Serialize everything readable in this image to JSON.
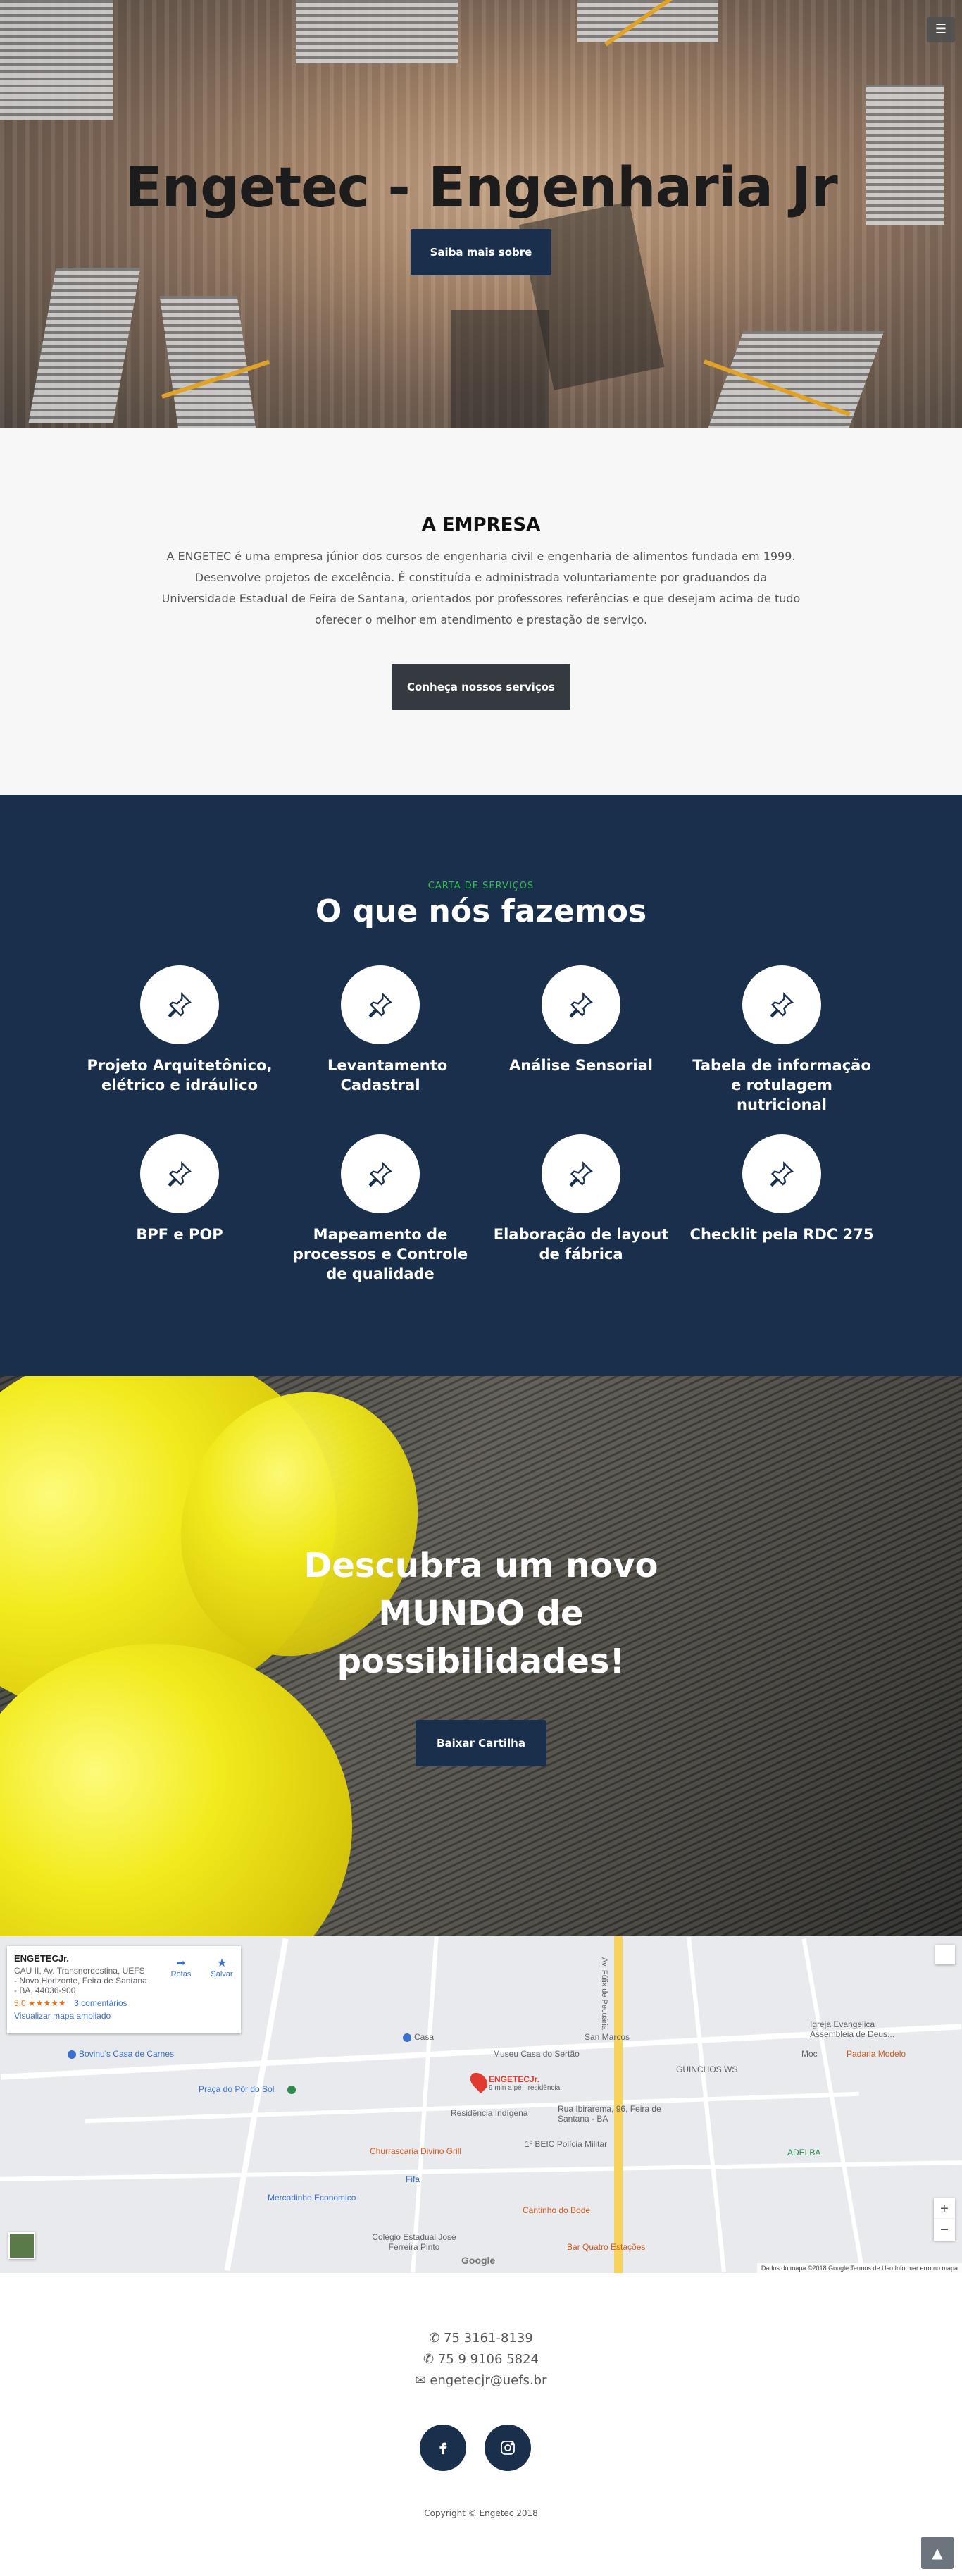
{
  "hero": {
    "title": "Engetec - Engenharia Jr",
    "button": "Saiba mais sobre",
    "menu_icon": "menu-icon"
  },
  "empresa": {
    "heading": "A EMPRESA",
    "text": "A ENGETEC é uma empresa júnior dos cursos de engenharia civil e engenharia de alimentos fundada em 1999. Desenvolve projetos de excelência. É constituída e administrada voluntariamente por graduandos da Universidade Estadual de Feira de Santana, orientados por professores referências e que desejam acima de tudo oferecer o melhor em atendimento e prestação de serviço.",
    "button": "Conheça nossos serviços"
  },
  "services": {
    "kicker": "CARTA DE SERVIÇOS",
    "heading": "O que nós fazemos",
    "items": [
      {
        "title": "Projeto Arquitetônico, elétrico e idráulico",
        "icon": "pushpin-icon"
      },
      {
        "title": "Levantamento Cadastral",
        "icon": "pushpin-icon"
      },
      {
        "title": "Análise Sensorial",
        "icon": "pushpin-icon"
      },
      {
        "title": "Tabela de informação e rotulagem nutricional",
        "icon": "pushpin-icon"
      },
      {
        "title": "BPF e POP",
        "icon": "pushpin-icon"
      },
      {
        "title": "Mapeamento de processos e Controle de qualidade",
        "icon": "pushpin-icon"
      },
      {
        "title": "Elaboração de layout de fábrica",
        "icon": "pushpin-icon"
      },
      {
        "title": "Checklit pela RDC 275",
        "icon": "pushpin-icon"
      }
    ]
  },
  "descubra": {
    "heading": "Descubra um novo MUNDO de possibilidades!",
    "button": "Baixar Cartilha"
  },
  "map": {
    "card": {
      "name": "ENGETECJr.",
      "address": "CAU II, Av. Transnordestina, UEFS - Novo Horizonte, Feira de Santana - BA, 44036-900",
      "rating": "5,0 ★★★★★",
      "comments": "3 comentários",
      "larger_map": "Visualizar mapa ampliado",
      "directions": "Rotas",
      "save": "Salvar"
    },
    "labels": {
      "bovinus": "Bovinu's Casa de Carnes",
      "casa": "Casa",
      "museu": "Museu Casa do Sertão",
      "san_marcos": "San Marcos",
      "igreja": "Igreja Evangelica Assembleia de Deus...",
      "moc": "Moc",
      "padaria": "Padaria Modelo",
      "guinchos": "GUINCHOS WS",
      "praca": "Praça do Pôr do Sol",
      "engetec": "ENGETECJr.",
      "engetec_sub": "9 min a pé · residência",
      "residencia": "Residência Indígena",
      "rua": "Rua Ibirarema, 96, Feira de Santana - BA",
      "churrascaria": "Churrascaria Divino Grill",
      "beic": "1º BEIC Polícia Militar",
      "fifa": "Fifa",
      "mercadinho": "Mercadinho Economico",
      "cantinho": "Cantinho do Bode",
      "colegio": "Colégio Estadual José Ferreira Pinto",
      "bar": "Bar Quatro Estações",
      "adelba": "ADELBA",
      "av": "Av. Fúlix de Pecuária"
    },
    "google": "Google",
    "footer": "Dados do mapa ©2018 Google   Termos de Uso   Informar erro no mapa",
    "zoom_in": "+",
    "zoom_out": "−"
  },
  "footer": {
    "phone1": "75 3161-8139",
    "phone2": "75 9 9106 5824",
    "email": "engetecjr@uefs.br",
    "copyright": "Copyright © Engetec 2018",
    "social": [
      "facebook-icon",
      "instagram-icon"
    ],
    "to_top": "▲"
  },
  "colors": {
    "navy": "#1a2f4c",
    "dark_button": "#343a40",
    "kicker_green": "#2fbf4f",
    "section_bg": "#f7f7f8"
  }
}
